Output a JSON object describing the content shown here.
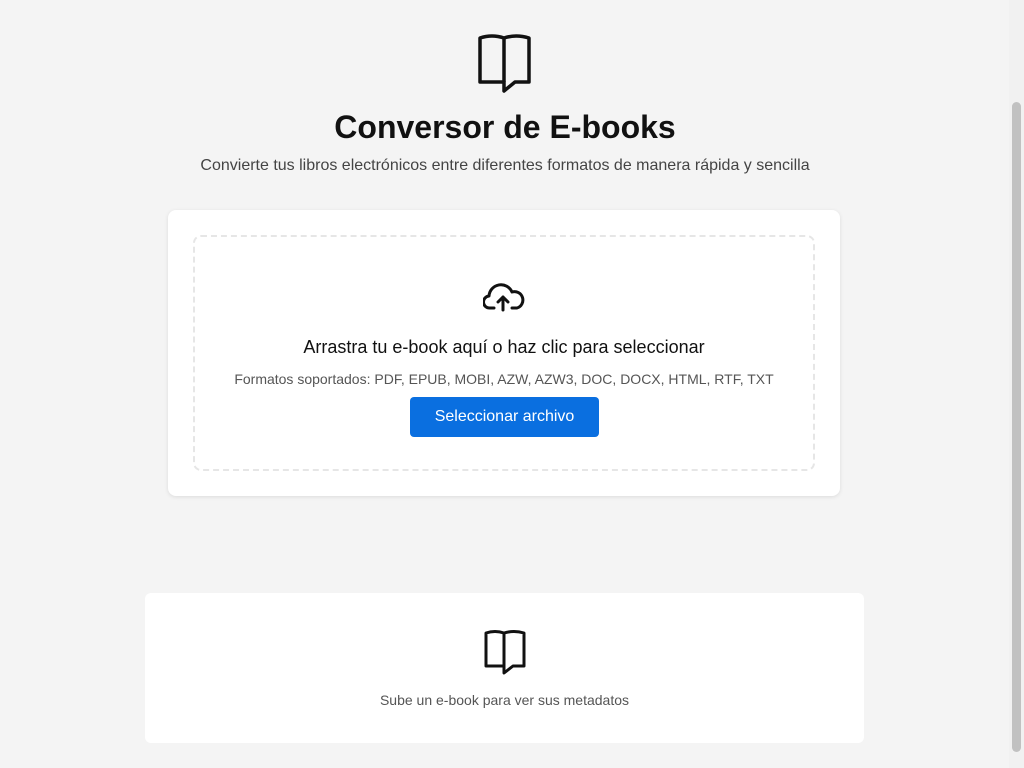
{
  "header": {
    "icon": "open-book-icon",
    "title": "Conversor de E-books",
    "subtitle": "Convierte tus libros electrónicos entre diferentes formatos de manera rápida y sencilla"
  },
  "upload": {
    "icon": "cloud-upload-icon",
    "title": "Arrastra tu e-book aquí o haz clic para seleccionar",
    "formats": "Formatos soportados: PDF, EPUB, MOBI, AZW, AZW3, DOC, DOCX, HTML, RTF, TXT",
    "button_label": "Seleccionar archivo"
  },
  "metadata": {
    "icon": "open-book-icon",
    "empty_text": "Sube un e-book para ver sus metadatos"
  },
  "colors": {
    "accent": "#0a6fe0",
    "background": "#f4f4f4",
    "card": "#ffffff"
  }
}
